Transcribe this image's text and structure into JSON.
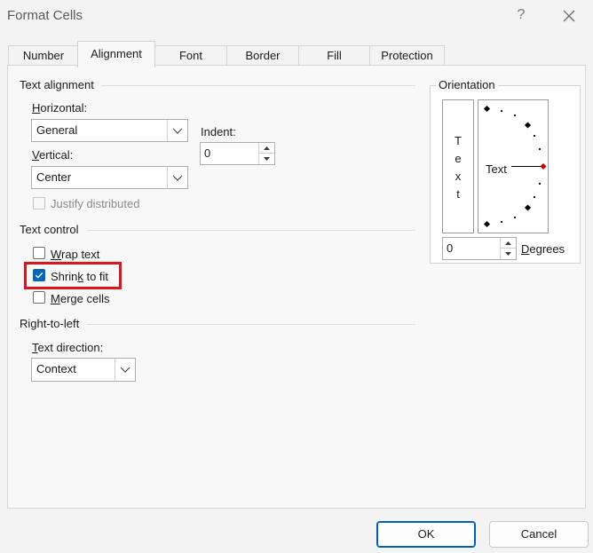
{
  "window": {
    "title": "Format Cells",
    "help": "?"
  },
  "tabs": [
    {
      "label": "Number"
    },
    {
      "label": "Alignment",
      "active": true
    },
    {
      "label": "Font"
    },
    {
      "label": "Border"
    },
    {
      "label": "Fill"
    },
    {
      "label": "Protection"
    }
  ],
  "text_alignment": {
    "heading": "Text alignment",
    "horizontal_label_u": "H",
    "horizontal_label_rest": "orizontal:",
    "horizontal_value": "General",
    "vertical_label_u": "V",
    "vertical_label_rest": "ertical:",
    "vertical_value": "Center",
    "indent_label": "Indent:",
    "indent_value": "0",
    "justify_distributed": "Justify distributed"
  },
  "text_control": {
    "heading": "Text control",
    "wrap_u": "W",
    "wrap_rest": "rap text",
    "shrink_pre": "Shrin",
    "shrink_u": "k",
    "shrink_post": " to fit",
    "merge_u": "M",
    "merge_rest": "erge cells",
    "wrap_checked": false,
    "shrink_checked": true,
    "merge_checked": false
  },
  "rtl": {
    "heading": "Right-to-left",
    "direction_label_u": "T",
    "direction_label_rest": "ext direction:",
    "direction_value": "Context"
  },
  "orientation": {
    "heading": "Orientation",
    "vertical_letters": [
      "T",
      "e",
      "x",
      "t"
    ],
    "dial_text": "Text",
    "degrees_value": "0",
    "degrees_label_u": "D",
    "degrees_label_rest": "egrees"
  },
  "buttons": {
    "ok": "OK",
    "cancel": "Cancel"
  },
  "colors": {
    "accent": "#0067c0",
    "highlight": "#e0141b",
    "dial_marker": "#c00000"
  },
  "icons": [
    "close-icon",
    "chevron-down-icon",
    "spin-up-icon",
    "spin-down-icon",
    "checkmark-icon"
  ]
}
